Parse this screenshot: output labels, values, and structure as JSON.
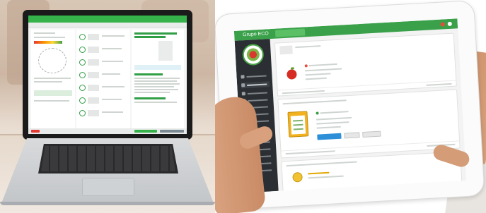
{
  "laptop_app": {
    "title_bar": "",
    "tabs": []
  },
  "tablet_app": {
    "app_name": "Grupo ECO",
    "active_tab": "",
    "brand_color": "#3aa14a",
    "sidebar_color": "#2b2f33",
    "button_color": "#2d8fd8"
  },
  "icons": [
    "apple-icon",
    "clipboard-icon",
    "medal-icon",
    "app-logo-icon"
  ]
}
